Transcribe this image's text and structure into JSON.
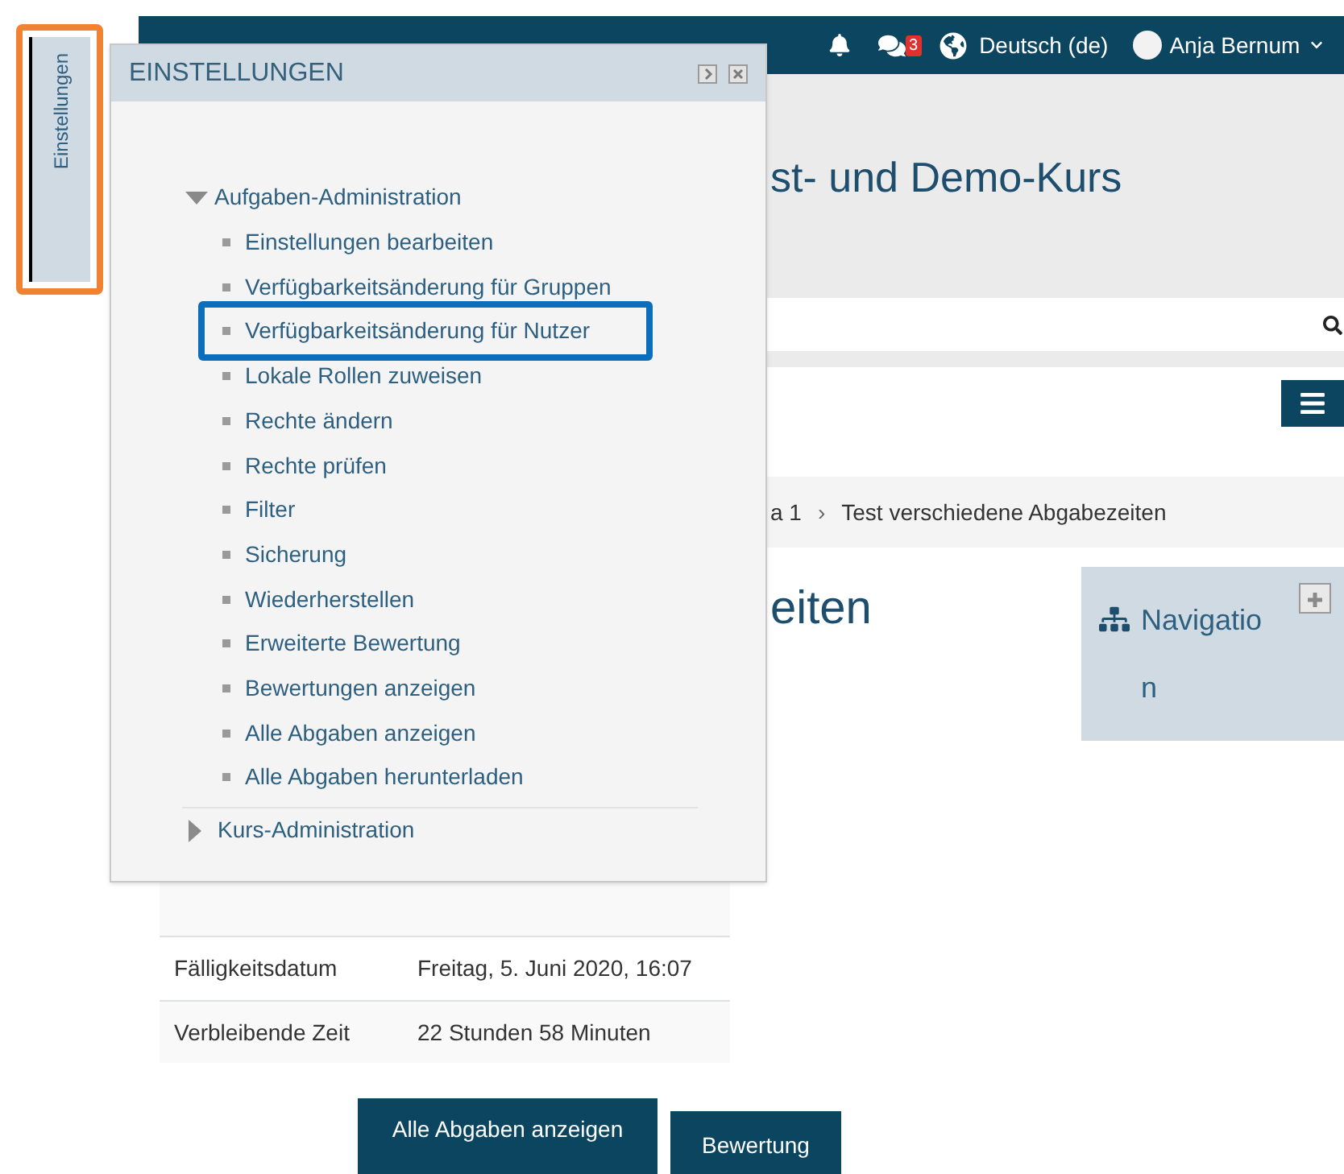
{
  "sidebar_tab": {
    "label": "Einstellungen",
    "highlighted": true
  },
  "top_bar": {
    "message_count": "3",
    "language": "Deutsch (de)",
    "user": "Anja Bernum"
  },
  "header": {
    "title": "st- und Demo-Kurs"
  },
  "breadcrumb": {
    "items": [
      "a 1",
      "Test verschiedene Abgabezeiten"
    ],
    "separator": "›"
  },
  "page_heading": "eiten",
  "navigation_block": {
    "title": "Navigation"
  },
  "table": {
    "rows": [
      {
        "kind": "covered"
      },
      {
        "kind": "text",
        "label": "Fälligkeitsdatum",
        "value": "Freitag, 5. Juni 2020, 16:07"
      },
      {
        "kind": "text",
        "label": "Verbleibende Zeit",
        "value": "22 Stunden 58 Minuten"
      }
    ]
  },
  "buttons": [
    "Alle Abgaben anzeigen",
    "Bewertung"
  ],
  "settings_panel": {
    "title": "EINSTELLUNGEN",
    "sections": [
      {
        "label": "Aufgaben-Administration",
        "expanded": true,
        "children": [
          {
            "label": "Einstellungen bearbeiten",
            "highlighted": false
          },
          {
            "label": "Verfügbarkeitsänderung für Gruppen",
            "highlighted": false
          },
          {
            "label": "Verfügbarkeitsänderung für Nutzer",
            "highlighted": true
          },
          {
            "label": "Lokale Rollen zuweisen",
            "highlighted": false
          },
          {
            "label": "Rechte ändern",
            "highlighted": false
          },
          {
            "label": "Rechte prüfen",
            "highlighted": false
          },
          {
            "label": "Filter",
            "highlighted": false
          },
          {
            "label": "Sicherung",
            "highlighted": false
          },
          {
            "label": "Wiederherstellen",
            "highlighted": false
          },
          {
            "label": "Erweiterte Bewertung",
            "highlighted": false
          },
          {
            "label": "Bewertungen anzeigen",
            "highlighted": false
          },
          {
            "label": "Alle Abgaben anzeigen",
            "highlighted": false
          },
          {
            "label": "Alle Abgaben herunterladen",
            "highlighted": false
          }
        ]
      },
      {
        "label": "Kurs-Administration",
        "expanded": false
      }
    ]
  }
}
